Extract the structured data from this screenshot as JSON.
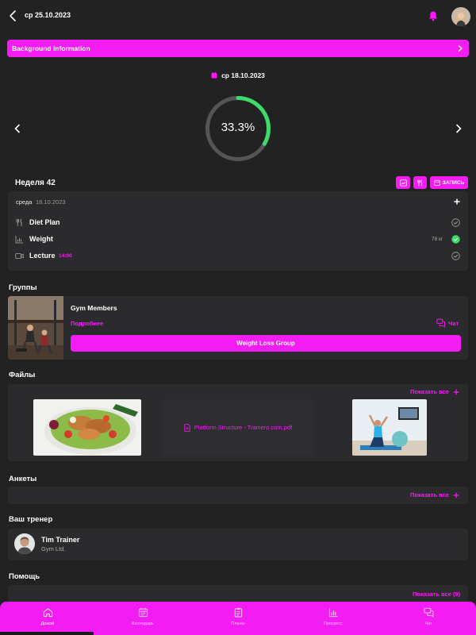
{
  "header": {
    "date": "ср 25.10.2023",
    "back_icon": "chevron-left-icon",
    "bell_icon": "bell-icon",
    "accent": "#ff16ff"
  },
  "banner": {
    "label": "Background information"
  },
  "progress": {
    "date": "ср 18.10.2023",
    "percent_label": "33.3%",
    "value": 0.333,
    "track_color": "#555555",
    "fill_color": "#3ddc6a"
  },
  "week": {
    "label": "Неделя 42",
    "record_label": "ЗАПИСЬ"
  },
  "day": {
    "name": "среда",
    "date": "18.10.2023",
    "rows": [
      {
        "label": "Diet Plan",
        "time": "",
        "value": "",
        "done": false
      },
      {
        "label": "Weight",
        "time": "",
        "value": "78 кг",
        "done": true
      },
      {
        "label": "Lecture",
        "time": "14:00",
        "value": "",
        "done": false
      }
    ]
  },
  "groups": {
    "title": "Группы",
    "name": "Gym Members",
    "more": "Подробнее",
    "chat": "Чат",
    "button": "Weight Loss Group"
  },
  "files": {
    "title": "Файлы",
    "show_all": "Показать все",
    "pdf_name": "Platform Structure - Trainero.com.pdf"
  },
  "surveys": {
    "title": "Анкеты",
    "show_all": "Показать все"
  },
  "trainer": {
    "title": "Ваш тренер",
    "name": "Tim Trainer",
    "org": "Gym Ltd."
  },
  "help": {
    "title": "Помощь",
    "show_all": "Показать все (9)"
  },
  "bottom_nav": [
    {
      "label": "Домой",
      "icon": "home-icon"
    },
    {
      "label": "Календарь",
      "icon": "calendar-icon"
    },
    {
      "label": "Планы",
      "icon": "clipboard-icon"
    },
    {
      "label": "Прогресс",
      "icon": "bar-chart-icon"
    },
    {
      "label": "Чат",
      "icon": "chat-icon"
    }
  ]
}
